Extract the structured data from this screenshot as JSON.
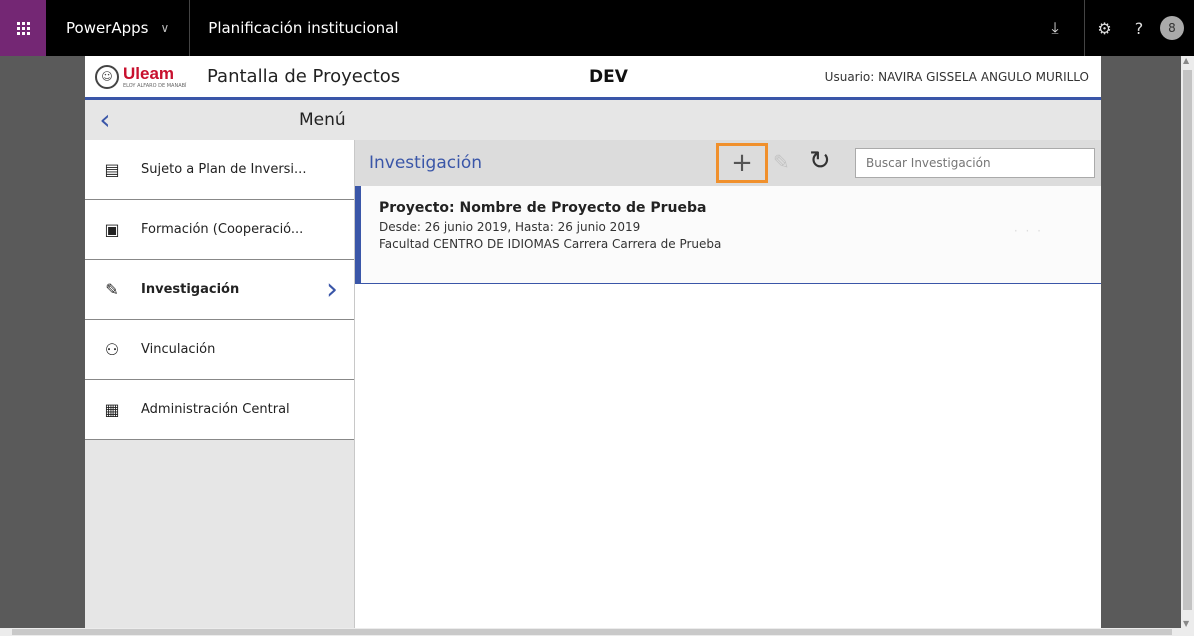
{
  "topbar": {
    "brand": "PowerApps",
    "brand_chevron": "∨",
    "app_title": "Planificación institucional",
    "download_icon": "⤓",
    "settings_icon": "⚙",
    "help_icon": "?",
    "avatar_icon": "8"
  },
  "header": {
    "logo_text": "Uleam",
    "logo_subtitle": "ELOY ALFARO DE MANABÍ",
    "page_title": "Pantalla de Proyectos",
    "environment": "DEV",
    "user": "Usuario: NAVIRA GISSELA ANGULO MURILLO"
  },
  "menubar": {
    "back_icon": "‹",
    "label": "Menú"
  },
  "sidebar": {
    "items": [
      {
        "label": "Sujeto a Plan de Inversi...",
        "icon": "document-list-icon",
        "glyph": "▤"
      },
      {
        "label": "Formación (Cooperació...",
        "icon": "contact-card-icon",
        "glyph": "▣"
      },
      {
        "label": "Investigación",
        "icon": "edit-note-icon",
        "glyph": "✎",
        "active": true,
        "arrow": "›"
      },
      {
        "label": "Vinculación",
        "icon": "people-icon",
        "glyph": "⚇"
      },
      {
        "label": "Administración Central",
        "icon": "building-icon",
        "glyph": "▦"
      }
    ]
  },
  "content": {
    "title": "Investigación",
    "add_icon": "+",
    "edit_icon": "✎",
    "refresh_icon": "↻",
    "search_placeholder": "Buscar Investigación",
    "records": [
      {
        "title": "Proyecto: Nombre de Proyecto de Prueba",
        "dates": "Desde: 26 junio 2019, Hasta: 26 junio 2019",
        "faculty": "Facultad CENTRO DE IDIOMAS Carrera Carrera de Prueba",
        "more": "· · ·"
      }
    ]
  },
  "colors": {
    "accent": "#3a56a8",
    "highlight": "#f0902c",
    "brand_purple": "#742774",
    "logo_red": "#c8102e"
  }
}
